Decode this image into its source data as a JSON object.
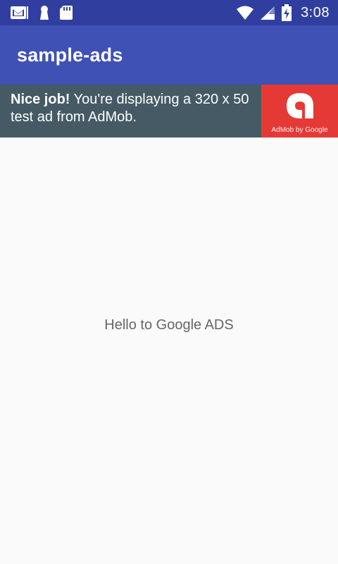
{
  "status_bar": {
    "time": "3:08",
    "icons": [
      "gmail-icon",
      "keyhole-icon",
      "sd-card-icon",
      "wifi-icon",
      "signal-icon",
      "battery-charging-icon"
    ]
  },
  "app_bar": {
    "title": "sample-ads"
  },
  "ad_banner": {
    "headline": "Nice job!",
    "message": " You're displaying a 320 x 50 test ad from AdMob.",
    "logo_caption": "AdMob by Google"
  },
  "main": {
    "text": "Hello to Google ADS"
  },
  "colors": {
    "status_bar": "#303f9f",
    "app_bar": "#3f51b5",
    "ad_background": "#455a64",
    "ad_logo_background": "#e53935",
    "page_background": "#fafafa",
    "body_text": "#666666"
  }
}
